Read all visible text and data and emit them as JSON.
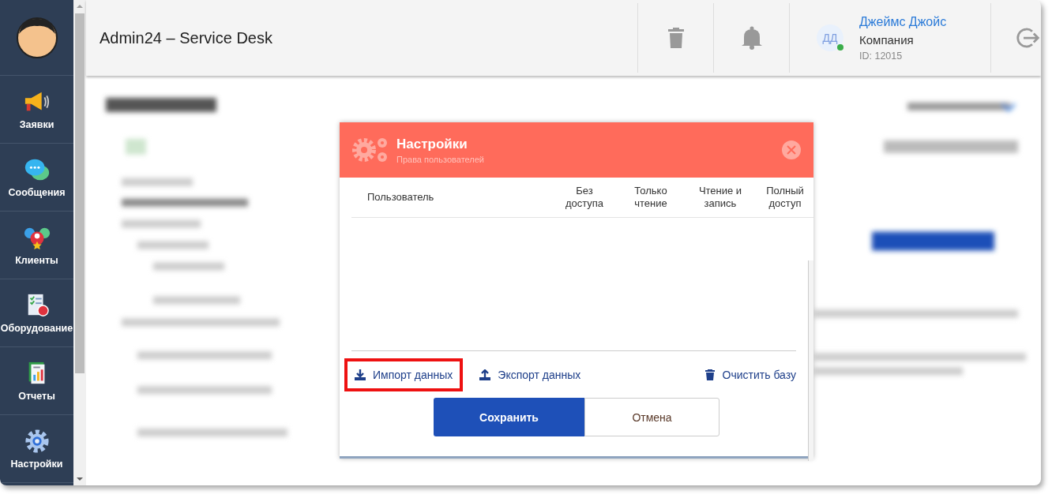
{
  "app": {
    "title": "Admin24 – Service Desk"
  },
  "sidebar": {
    "items": [
      {
        "label": "Заявки"
      },
      {
        "label": "Сообщения"
      },
      {
        "label": "Клиенты"
      },
      {
        "label": "Оборудование"
      },
      {
        "label": "Отчеты"
      },
      {
        "label": "Настройки"
      }
    ]
  },
  "header": {
    "user": {
      "initials": "ДД",
      "online": true,
      "name": "Джеймс Джойс",
      "company": "Компания",
      "id": "ID: 12015"
    }
  },
  "modal": {
    "title": "Настройки",
    "subtitle": "Права пользователей",
    "columns": [
      "Пользователь",
      "Без доступа",
      "Только чтение",
      "Чтение и запись",
      "Полный доступ"
    ],
    "actions": [
      {
        "label": "Импорт данных",
        "highlighted": true
      },
      {
        "label": "Экспорт данных",
        "highlighted": false
      },
      {
        "label": "Очистить базу",
        "highlighted": false
      }
    ],
    "buttons": [
      {
        "label": "Сохранить",
        "primary": true
      },
      {
        "label": "Отмена",
        "primary": false
      }
    ]
  }
}
